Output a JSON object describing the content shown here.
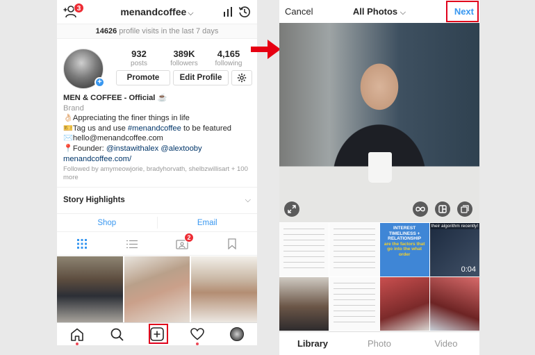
{
  "profile": {
    "notification_count": "3",
    "username": "menandcoffee",
    "visits_count": "14626",
    "visits_text": " profile visits in the last 7 days",
    "stats": [
      {
        "value": "932",
        "label": "posts"
      },
      {
        "value": "389K",
        "label": "followers"
      },
      {
        "value": "4,165",
        "label": "following"
      }
    ],
    "promote_label": "Promote",
    "edit_profile_label": "Edit Profile",
    "display_name": "MEN & COFFEE - Official ☕",
    "category": "Brand",
    "bio_line1": "👌🏻Appreciating the finer things in life",
    "bio_line2_prefix": "🎫Tag us and use ",
    "bio_line2_tag": "#menandcoffee",
    "bio_line2_suffix": " to be featured",
    "bio_line3": "✉️hello@menandcoffee.com",
    "bio_line4_prefix": "📍Founder: ",
    "bio_line4_m1": "@instawithalex",
    "bio_line4_m2": "@alextooby",
    "website": "menandcoffee.com/",
    "followed_by": "Followed by amymeowjorie, bradyhorvath, shelbzwillisart + 100 more",
    "story_highlights": "Story Highlights",
    "shop_label": "Shop",
    "email_label": "Email",
    "tagged_count": "2"
  },
  "gallery": {
    "cancel_label": "Cancel",
    "album_label": "All Photos",
    "next_label": "Next",
    "thumb_interest_text": "INTEREST TIMELINESS + RELATIONSHIP",
    "thumb_interest_sub": "are the factors that go into the what order",
    "thumb_video_caption": "their algorithm recently!",
    "thumb_video_duration": "0:04",
    "tabs": [
      "Library",
      "Photo",
      "Video"
    ],
    "active_tab": "Library"
  },
  "colors": {
    "accent_blue": "#3897f0",
    "highlight_red": "#e0001b",
    "badge_red": "#ed2d35"
  }
}
